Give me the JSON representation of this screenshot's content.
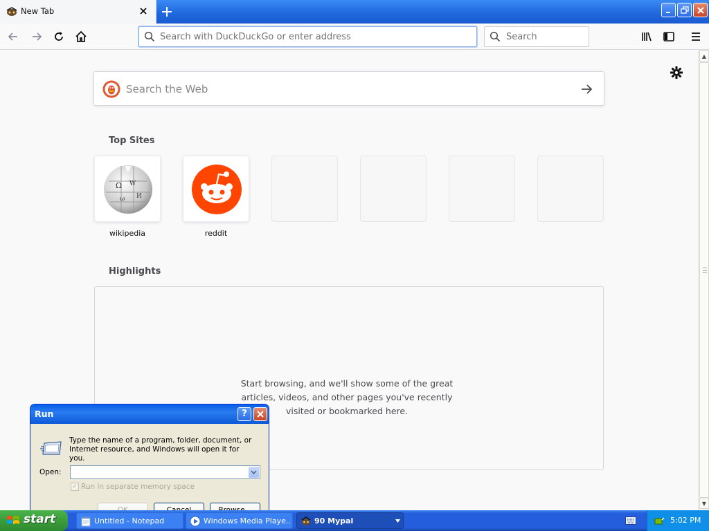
{
  "browser": {
    "tab": {
      "title": "New Tab"
    },
    "urlbar": {
      "placeholder": "Search with DuckDuckGo or enter address"
    },
    "searchbar": {
      "placeholder": "Search"
    }
  },
  "newtab": {
    "websearch": {
      "placeholder": "Search the Web"
    },
    "top_sites": {
      "title": "Top Sites",
      "sites": [
        {
          "label": "wikipedia",
          "icon": "wikipedia-globe-icon"
        },
        {
          "label": "reddit",
          "icon": "reddit-icon",
          "color": "#ff4500"
        }
      ],
      "empty_slots": 4
    },
    "highlights": {
      "title": "Highlights",
      "message": "Start browsing, and we'll show some of the great articles, videos, and other pages you've recently visited or bookmarked here."
    }
  },
  "run_dialog": {
    "title": "Run",
    "help_label": "?",
    "description": "Type the name of a program, folder, document, or Internet resource, and Windows will open it for you.",
    "open_label": "Open:",
    "open_value": "",
    "checkbox_label": "Run in separate memory space",
    "checkbox_checked": true,
    "ok_label": "OK",
    "cancel_label": "Cancel",
    "browse_label": "Browse..."
  },
  "taskbar": {
    "start_label": "start",
    "tasks": [
      {
        "label": "Untitled - Notepad",
        "icon": "notepad-icon",
        "active": false
      },
      {
        "label": "Windows Media Playe...",
        "icon": "media-player-icon",
        "active": false
      },
      {
        "label": "90 Mypal",
        "icon": "mypal-icon",
        "active": true
      }
    ],
    "clock": "5:02 PM"
  },
  "colors": {
    "xp_blue": "#245edc",
    "start_green": "#3c9c3c",
    "accent_blue": "#0a84ff",
    "reddit_orange": "#ff4500",
    "ddg_orange": "#de5833"
  }
}
